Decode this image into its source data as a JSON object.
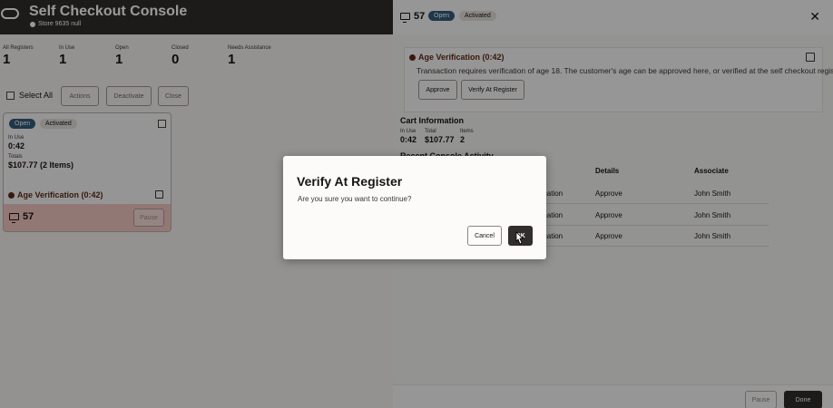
{
  "app": {
    "title": "Self Checkout Console",
    "store": "Store 9635 null"
  },
  "stats": [
    {
      "label": "All Registers",
      "value": "1"
    },
    {
      "label": "In Use",
      "value": "1"
    },
    {
      "label": "Open",
      "value": "1"
    },
    {
      "label": "Closed",
      "value": "0"
    },
    {
      "label": "Needs Assistance",
      "value": "1"
    }
  ],
  "toolbar": {
    "select_all": "Select All",
    "actions": "Actions",
    "deactivate": "Deactivate",
    "close": "Close"
  },
  "register_card": {
    "badge_open": "Open",
    "badge_activated": "Activated",
    "in_use_label": "In Use",
    "in_use_value": "0:42",
    "totals_label": "Totals",
    "totals_value": "$107.77 (2 Items)",
    "alert": "Age Verification (0:42)",
    "register_number": "57",
    "pause_label": "Pause"
  },
  "drawer": {
    "register_number": "57",
    "badge_open": "Open",
    "badge_activated": "Activated",
    "alert_title": "Age Verification (0:42)",
    "alert_text": "Transaction requires verification of age 18. The customer's age can be approved here, or verified at the self checkout register.",
    "approve": "Approve",
    "verify_at_register": "Verify At Register",
    "cart_title": "Cart Information",
    "cart": [
      {
        "label": "In Use",
        "value": "0:42"
      },
      {
        "label": "Total",
        "value": "$107.77"
      },
      {
        "label": "Items",
        "value": "2"
      }
    ],
    "activity_title": "Recent Console Activity",
    "columns": {
      "details": "Details",
      "associate": "Associate"
    },
    "rows": [
      {
        "action": "ification",
        "details": "Approve",
        "associate": "John Smith"
      },
      {
        "action": "ification",
        "details": "Approve",
        "associate": "John Smith"
      },
      {
        "action": "ification",
        "details": "Approve",
        "associate": "John Smith"
      }
    ],
    "pause": "Pause",
    "done": "Done"
  },
  "modal": {
    "title": "Verify At Register",
    "message": "Are you sure you want to continue?",
    "cancel": "Cancel",
    "ok": "OK"
  },
  "colors": {
    "header": "#312d2a",
    "open_badge": "#355d7e",
    "alert": "#5d2c17",
    "needs_assist": "#f3c8c4"
  }
}
